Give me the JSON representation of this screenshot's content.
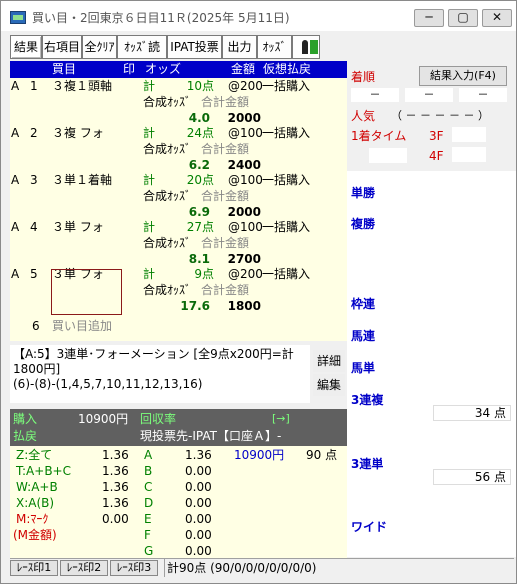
{
  "window": {
    "title": "買い目・2回東京６日目11Ｒ(2025年 5月11日)",
    "controls": [
      "─",
      "▢",
      "✕"
    ]
  },
  "toolbar": [
    "結果",
    "右項目",
    "全ｸﾘｱ",
    "ｵｯｽﾞ読",
    "IPAT投票",
    "出力",
    "ｵｯｽﾞ"
  ],
  "table": {
    "headers": [
      "買目",
      "印",
      "オッズ",
      "金額",
      "仮想払戻"
    ],
    "rows": [
      {
        "group": "A",
        "no": "1",
        "bet": "３複１頭軸",
        "count_label": "計",
        "count": "10点",
        "unit": "@200",
        "method": "一括購入",
        "odds_label": "合成ｵｯｽﾞ",
        "total_label": "合計金額",
        "odds": "4.0",
        "total": "2000"
      },
      {
        "group": "A",
        "no": "2",
        "bet": "３複 フォ",
        "count_label": "計",
        "count": "24点",
        "unit": "@100",
        "method": "一括購入",
        "odds_label": "合成ｵｯｽﾞ",
        "total_label": "合計金額",
        "odds": "6.2",
        "total": "2400"
      },
      {
        "group": "A",
        "no": "3",
        "bet": "３単１着軸",
        "count_label": "計",
        "count": "20点",
        "unit": "@100",
        "method": "一括購入",
        "odds_label": "合成ｵｯｽﾞ",
        "total_label": "合計金額",
        "odds": "6.9",
        "total": "2000"
      },
      {
        "group": "A",
        "no": "4",
        "bet": "３単 フォ",
        "count_label": "計",
        "count": "27点",
        "unit": "@100",
        "method": "一括購入",
        "odds_label": "合成ｵｯｽﾞ",
        "total_label": "合計金額",
        "odds": "8.1",
        "total": "2700"
      },
      {
        "group": "A",
        "no": "5",
        "bet": "３単 フォ",
        "count_label": "計",
        "count": "9点",
        "unit": "@200",
        "method": "一括購入",
        "odds_label": "合成ｵｯｽﾞ",
        "total_label": "合計金額",
        "odds": "17.6",
        "total": "1800"
      }
    ],
    "add_row": {
      "no": "6",
      "label": "買い目追加"
    }
  },
  "info": {
    "line1": "【A:5】3連単･フォーメーション [全9点x200円=計1800円]",
    "line2": "(6)-(8)-(1,4,5,7,10,11,12,13,16)",
    "detail_btn": "詳細",
    "edit_btn": "編集"
  },
  "summary": {
    "purchase_label": "購入",
    "purchase_value": "10900円",
    "recovery_label": "回収率",
    "arrow_btn": "[→]",
    "refund_label": "払戻",
    "target_text": "現投票先-IPAT【口座Ａ】-"
  },
  "stats": {
    "left": [
      {
        "label": "Z:全て",
        "value": "1.36",
        "color": "green"
      },
      {
        "label": "T:A+B+C",
        "value": "1.36",
        "color": "green"
      },
      {
        "label": "W:A+B",
        "value": "1.36",
        "color": "green"
      },
      {
        "label": "X:A(B)",
        "value": "1.36",
        "color": "green"
      },
      {
        "label": "M:ﾏｰｸ",
        "value": "0.00",
        "color": "red"
      },
      {
        "label": "(M金額)",
        "value": "",
        "color": "red"
      }
    ],
    "right": [
      {
        "label": "A",
        "value": "1.36",
        "extra": "10900円",
        "extra2": "90 点"
      },
      {
        "label": "B",
        "value": "0.00"
      },
      {
        "label": "C",
        "value": "0.00"
      },
      {
        "label": "D",
        "value": "0.00"
      },
      {
        "label": "E",
        "value": "0.00"
      },
      {
        "label": "F",
        "value": "0.00"
      },
      {
        "label": "G",
        "value": "0.00"
      }
    ]
  },
  "right_panel": {
    "order_label": "着順",
    "result_btn": "結果入力(F4)",
    "dash_boxes": [
      "－",
      "－",
      "－"
    ],
    "popularity_label": "人気",
    "popularity_value": "（ －  －  －  －  － ）",
    "time_label": "1着タイム",
    "f3_label": "3F",
    "f4_label": "4F",
    "bet_types": [
      "単勝",
      "複勝",
      "枠連",
      "馬連",
      "馬単",
      "3連複",
      "3連単",
      "ワイド"
    ],
    "trio_points": "34 点",
    "trifecta_points": "56 点"
  },
  "status": {
    "buttons": [
      "ﾚｰｽ印1",
      "ﾚｰｽ印2",
      "ﾚｰｽ印3"
    ],
    "text": "計90点 (90/0/0/0/0/0/0/0)"
  }
}
